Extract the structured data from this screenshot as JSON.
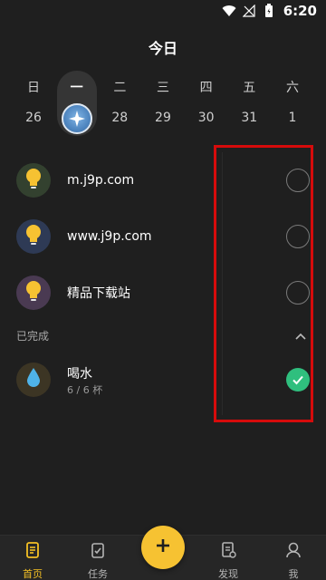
{
  "status_bar": {
    "time": "6:20"
  },
  "header": {
    "title": "今日"
  },
  "week": {
    "days": [
      {
        "name": "日",
        "num": "26"
      },
      {
        "name": "一",
        "num": ""
      },
      {
        "name": "二",
        "num": "28"
      },
      {
        "name": "三",
        "num": "29"
      },
      {
        "name": "四",
        "num": "30"
      },
      {
        "name": "五",
        "num": "31"
      },
      {
        "name": "六",
        "num": "1"
      }
    ],
    "selected_index": 1
  },
  "tasks": [
    {
      "label": "m.j9p.com",
      "icon": "lightbulb-icon",
      "avatar_color": "#33412f"
    },
    {
      "label": "www.j9p.com",
      "icon": "lightbulb-icon",
      "avatar_color": "#2e3a55"
    },
    {
      "label": "精品下载站",
      "icon": "lightbulb-icon",
      "avatar_color": "#4a3a52"
    }
  ],
  "completed": {
    "header": "已完成",
    "items": [
      {
        "label": "喝水",
        "sub": "6 / 6 杯",
        "icon": "water-drop-icon"
      }
    ]
  },
  "bottom_nav": {
    "items": [
      {
        "label": "首页",
        "icon": "home-doc-icon",
        "active": true
      },
      {
        "label": "任务",
        "icon": "task-check-icon",
        "active": false
      },
      {
        "label": "发现",
        "icon": "discover-icon",
        "active": false
      },
      {
        "label": "我",
        "icon": "profile-icon",
        "active": false
      }
    ]
  },
  "colors": {
    "accent": "#f6c232",
    "done_green": "#2fbf7e",
    "highlight": "#d60b0b"
  }
}
